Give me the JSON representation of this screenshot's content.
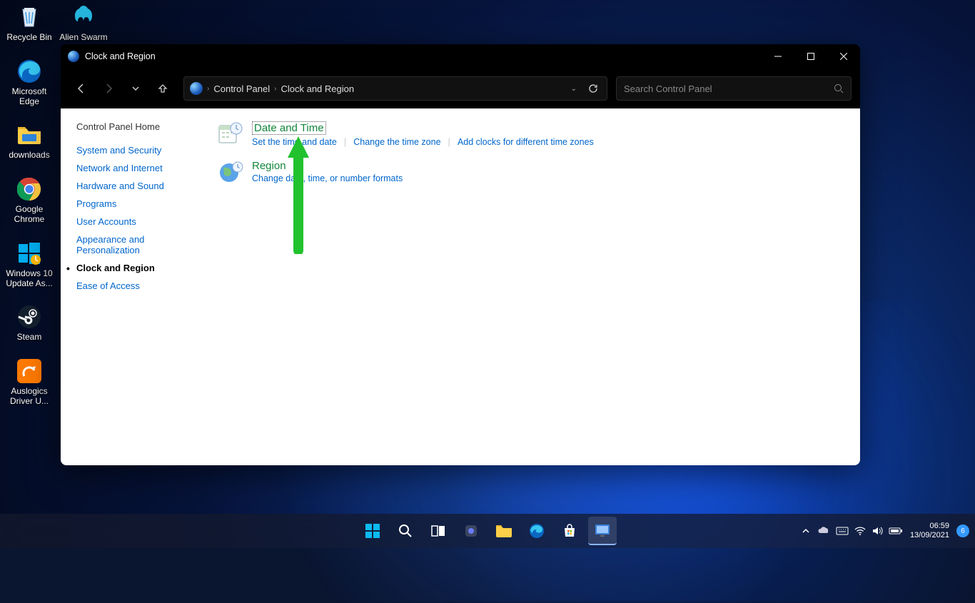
{
  "desktop": {
    "icons": [
      {
        "label": "Recycle Bin"
      },
      {
        "label": "Microsoft Edge"
      },
      {
        "label": "downloads"
      },
      {
        "label": "Google Chrome"
      },
      {
        "label": "Windows 10 Update As..."
      },
      {
        "label": "Steam"
      },
      {
        "label": "Auslogics Driver U..."
      }
    ],
    "icons_row2": [
      {
        "label": "Alien Swarm"
      }
    ]
  },
  "window": {
    "title": "Clock and Region",
    "breadcrumb": {
      "root": "Control Panel",
      "section": "Clock and Region"
    },
    "search_placeholder": "Search Control Panel",
    "sidebar": {
      "home": "Control Panel Home",
      "items": [
        {
          "label": "System and Security"
        },
        {
          "label": "Network and Internet"
        },
        {
          "label": "Hardware and Sound"
        },
        {
          "label": "Programs"
        },
        {
          "label": "User Accounts"
        },
        {
          "label": "Appearance and Personalization"
        },
        {
          "label": "Clock and Region"
        },
        {
          "label": "Ease of Access"
        }
      ]
    },
    "main": {
      "datetime": {
        "title": "Date and Time",
        "links": [
          "Set the time and date",
          "Change the time zone",
          "Add clocks for different time zones"
        ]
      },
      "region": {
        "title": "Region",
        "links": [
          "Change date, time, or number formats"
        ]
      }
    }
  },
  "taskbar": {
    "time": "06:59",
    "date": "13/09/2021",
    "notif_count": "6"
  }
}
